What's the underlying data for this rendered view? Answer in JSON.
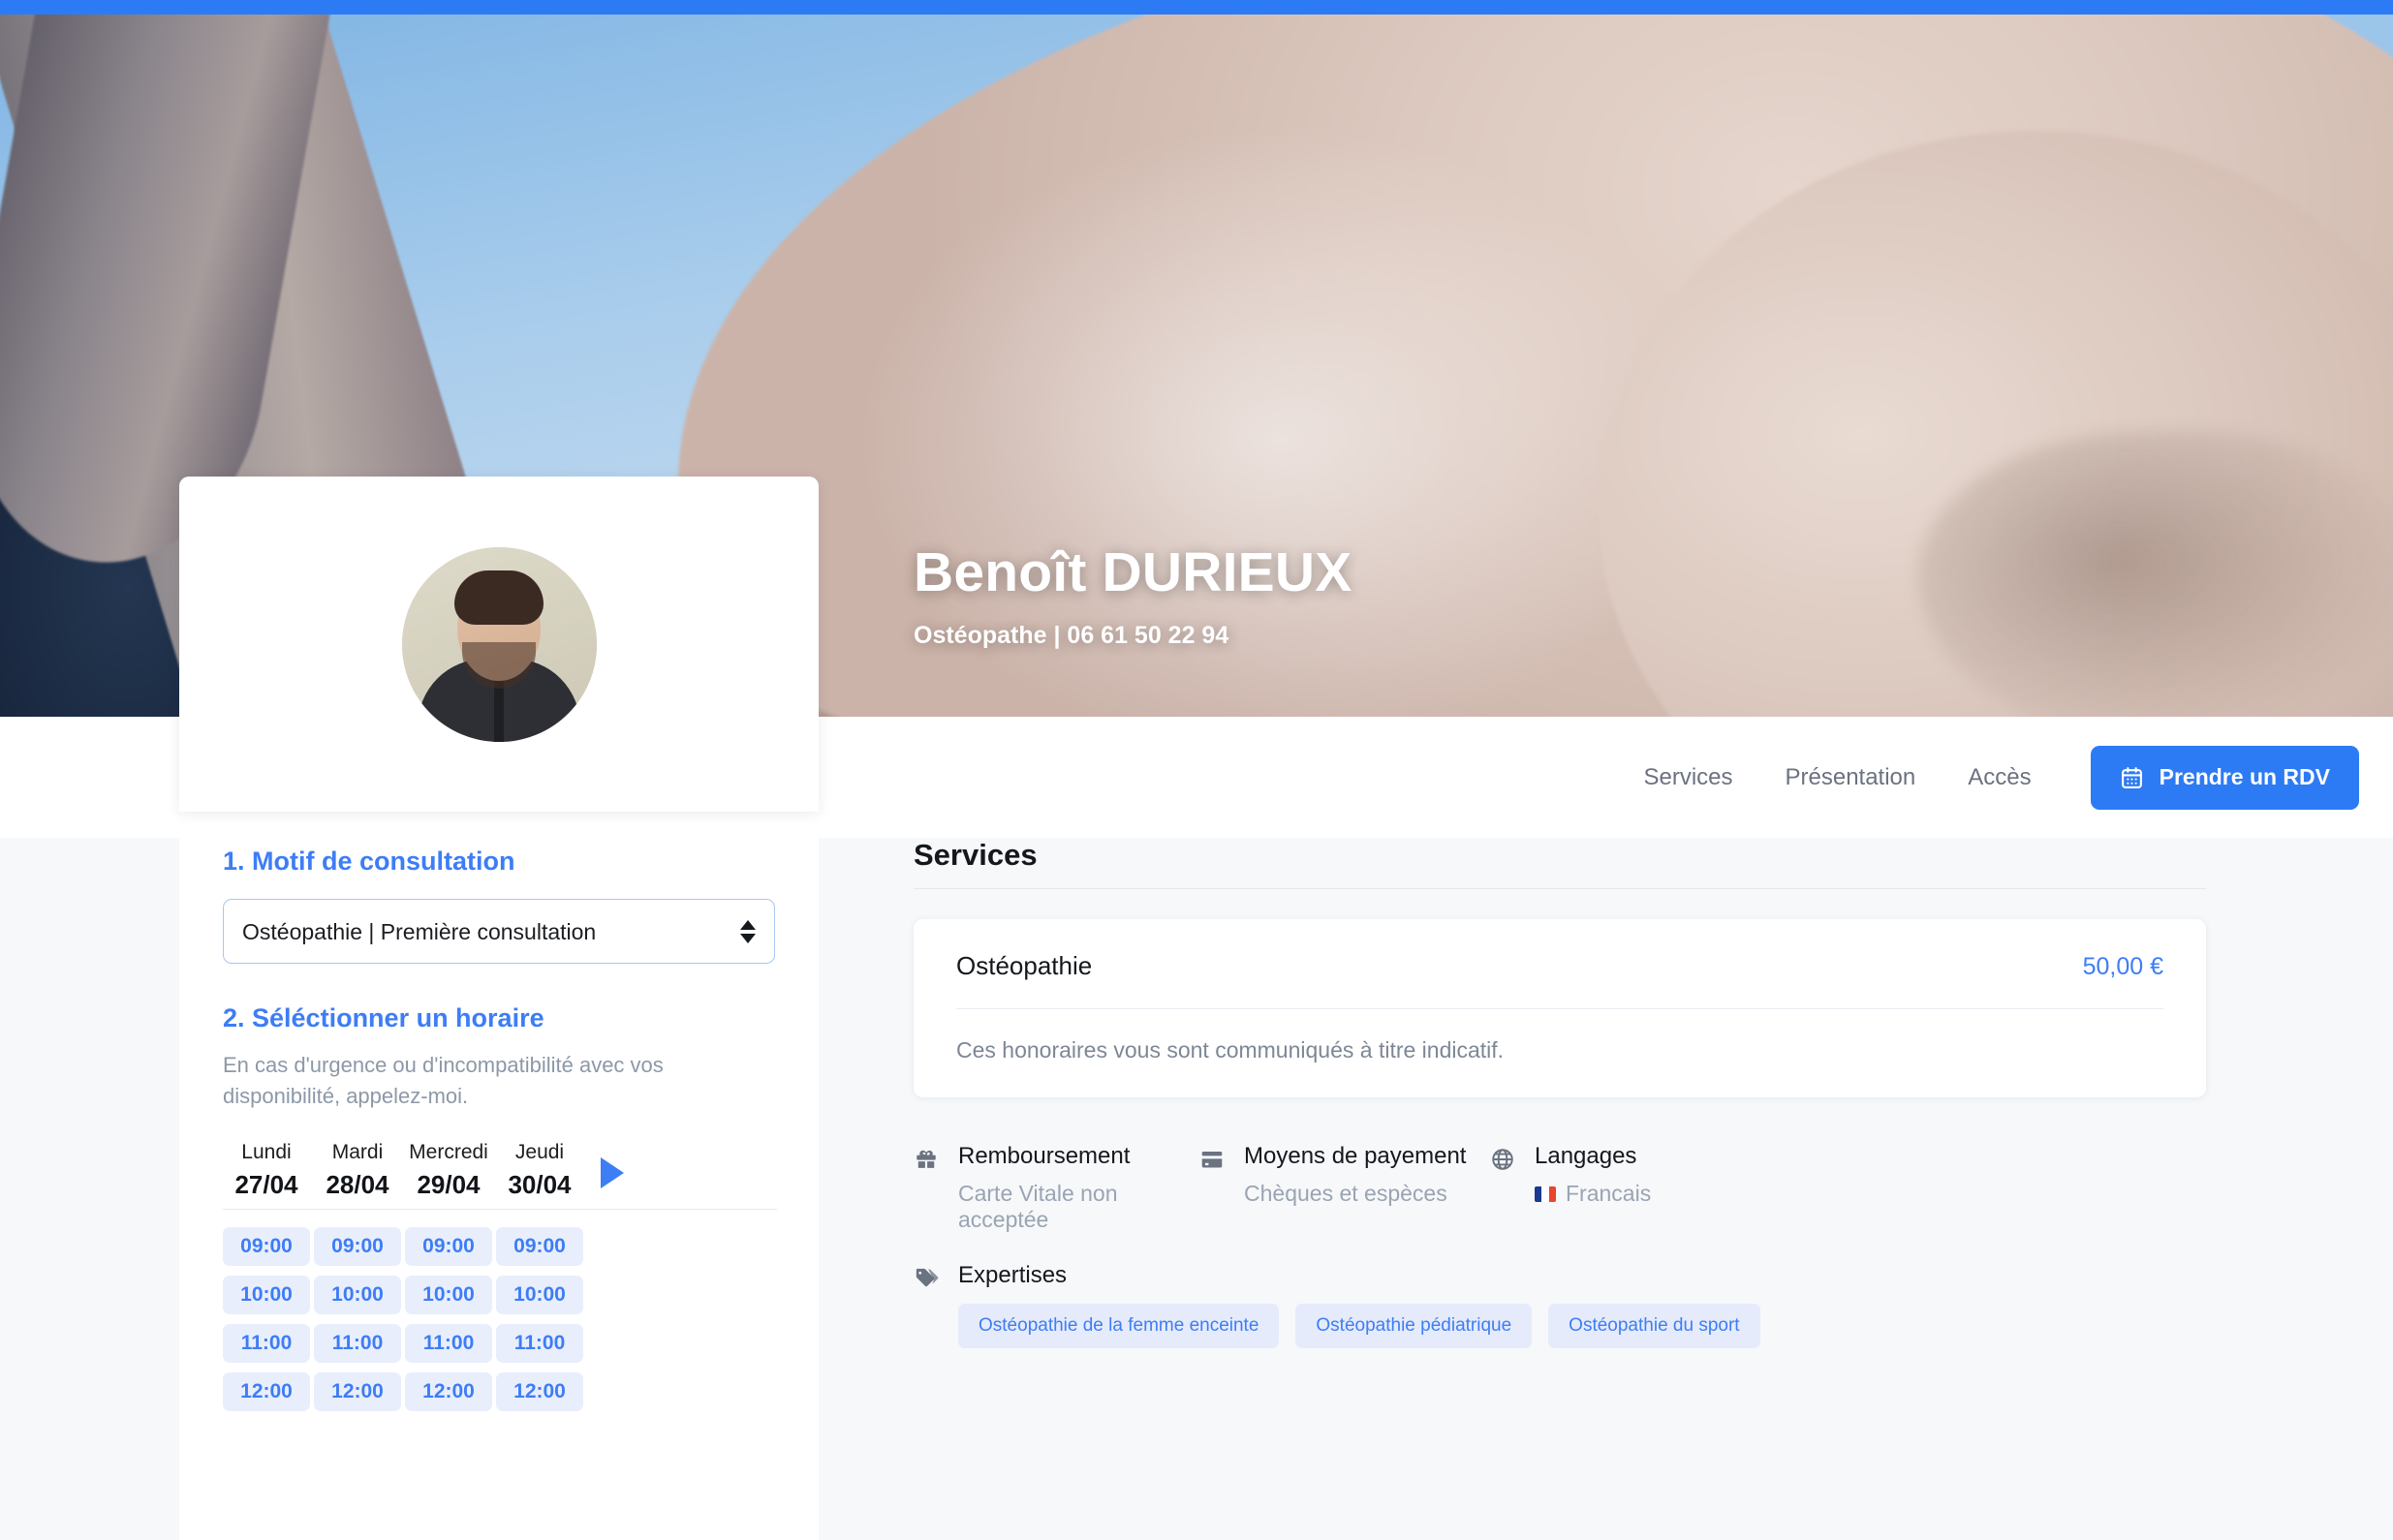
{
  "theme": {
    "accent": "#2d7bf4",
    "link_blue": "#3d7df6",
    "tag_bg": "#e5ebfa",
    "slot_bg": "#e9eefc",
    "page_bg": "#f6f8fa",
    "muted": "#9aa4b2"
  },
  "hero": {
    "name": "Benoît DURIEUX",
    "subtitle": "Ostéopathe | 06 61 50 22 94"
  },
  "nav": {
    "links": [
      {
        "label": "Services"
      },
      {
        "label": "Présentation"
      },
      {
        "label": "Accès"
      }
    ],
    "cta": {
      "label": "Prendre un RDV",
      "icon": "calendar-icon"
    }
  },
  "profile": {
    "avatar_alt": "Benoît DURIEUX"
  },
  "booking": {
    "step1_title": "1. Motif de consultation",
    "motif": {
      "selected": "Ostéopathie | Première consultation",
      "options": [
        "Ostéopathie | Première consultation"
      ]
    },
    "step2_title": "2. Séléctionner un horaire",
    "help_text": "En cas d'urgence ou d'incompatibilité avec vos disponibilité, appelez-moi.",
    "next_week_icon": "chevron-right-icon",
    "days": [
      {
        "name": "Lundi",
        "date": "27/04"
      },
      {
        "name": "Mardi",
        "date": "28/04"
      },
      {
        "name": "Mercredi",
        "date": "29/04"
      },
      {
        "name": "Jeudi",
        "date": "30/04"
      }
    ],
    "slot_rows": [
      [
        "09:00",
        "09:00",
        "09:00",
        "09:00"
      ],
      [
        "10:00",
        "10:00",
        "10:00",
        "10:00"
      ],
      [
        "11:00",
        "11:00",
        "11:00",
        "11:00"
      ],
      [
        "12:00",
        "12:00",
        "12:00",
        "12:00"
      ]
    ]
  },
  "services": {
    "title": "Services",
    "items": [
      {
        "name": "Ostéopathie",
        "price": "50,00 €"
      }
    ],
    "note": "Ces honoraires vous sont communiqués à titre indicatif."
  },
  "infos": [
    {
      "icon": "gift-icon",
      "label": "Remboursement",
      "value": "Carte Vitale non acceptée"
    },
    {
      "icon": "credit-card-icon",
      "label": "Moyens de payement",
      "value": "Chèques et espèces"
    },
    {
      "icon": "globe-icon",
      "label": "Langages",
      "value": "Francais",
      "flag": "fr"
    }
  ],
  "expertises": {
    "icon": "tag-icon",
    "label": "Expertises",
    "tags": [
      "Ostéopathie de la femme enceinte",
      "Ostéopathie pédiatrique",
      "Ostéopathie du sport"
    ]
  }
}
